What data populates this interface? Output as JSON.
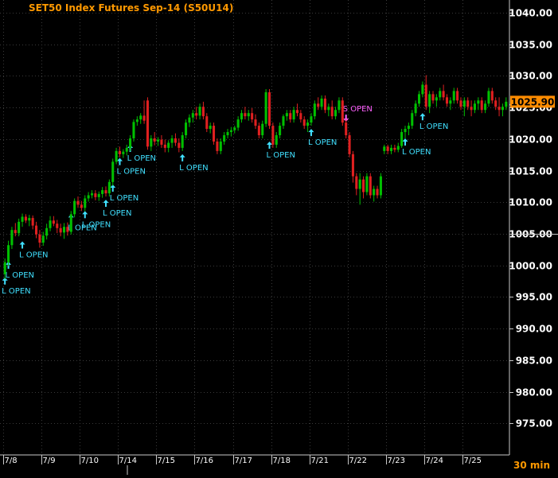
{
  "chart_data": {
    "type": "candlestick",
    "title": "SET50  Index  Futures  Sep-14  (S50U14)",
    "interval_label": "30  min",
    "current_price": "1025.90",
    "ylim": [
      970,
      1042
    ],
    "y_ticks": [
      "1040.00",
      "1035.00",
      "1030.00",
      "1025.00",
      "1020.00",
      "1015.00",
      "1010.00",
      "1005.00",
      "1000.00",
      "995.00",
      "990.00",
      "985.00",
      "980.00",
      "975.00"
    ],
    "y_tick_values": [
      1040,
      1035,
      1030,
      1025,
      1020,
      1015,
      1010,
      1005,
      1000,
      995,
      990,
      985,
      980,
      975
    ],
    "x_ticks": [
      "7/8",
      "7/9",
      "7/10",
      "7/14",
      "7/15",
      "7/16",
      "7/17",
      "7/18",
      "7/21",
      "7/22",
      "7/23",
      "7/24",
      "7/25"
    ],
    "grid": true,
    "colors": {
      "up": "#00c000",
      "down": "#e02020",
      "long_signal": "#40e0ff",
      "short_signal": "#ff60ff",
      "title": "#ff9900",
      "current_price_bg": "#ff8c00"
    },
    "candles": [
      {
        "o": 998.6,
        "h": 1001.1,
        "l": 997.8,
        "c": 1000.5
      },
      {
        "o": 1000.5,
        "h": 1003.9,
        "l": 999.9,
        "c": 1003.2
      },
      {
        "o": 1003.2,
        "h": 1006.1,
        "l": 1002.6,
        "c": 1005.6
      },
      {
        "o": 1005.6,
        "h": 1006.7,
        "l": 1004.6,
        "c": 1005.1
      },
      {
        "o": 1005.1,
        "h": 1007.4,
        "l": 1004.6,
        "c": 1006.9
      },
      {
        "o": 1006.9,
        "h": 1008.2,
        "l": 1006.1,
        "c": 1007.7
      },
      {
        "o": 1007.7,
        "h": 1008.1,
        "l": 1006.7,
        "c": 1007.1
      },
      {
        "o": 1007.1,
        "h": 1008.0,
        "l": 1006.2,
        "c": 1007.5
      },
      {
        "o": 1007.5,
        "h": 1007.9,
        "l": 1005.7,
        "c": 1006.3
      },
      {
        "o": 1006.3,
        "h": 1006.9,
        "l": 1004.3,
        "c": 1004.9
      },
      {
        "o": 1004.9,
        "h": 1005.6,
        "l": 1002.8,
        "c": 1003.6
      },
      {
        "o": 1003.6,
        "h": 1005.3,
        "l": 1003.1,
        "c": 1004.7
      },
      {
        "o": 1004.7,
        "h": 1006.6,
        "l": 1004.1,
        "c": 1005.9
      },
      {
        "o": 1005.9,
        "h": 1007.8,
        "l": 1005.4,
        "c": 1007.1
      },
      {
        "o": 1007.1,
        "h": 1007.8,
        "l": 1006.2,
        "c": 1006.6
      },
      {
        "o": 1006.6,
        "h": 1007.2,
        "l": 1005.1,
        "c": 1005.9
      },
      {
        "o": 1005.9,
        "h": 1006.6,
        "l": 1004.6,
        "c": 1005.2
      },
      {
        "o": 1005.2,
        "h": 1006.7,
        "l": 1004.2,
        "c": 1006.1
      },
      {
        "o": 1006.1,
        "h": 1006.8,
        "l": 1004.7,
        "c": 1005.3
      },
      {
        "o": 1005.3,
        "h": 1008.6,
        "l": 1004.9,
        "c": 1008.1
      },
      {
        "o": 1008.1,
        "h": 1010.6,
        "l": 1007.6,
        "c": 1010.2
      },
      {
        "o": 1010.2,
        "h": 1010.9,
        "l": 1009.1,
        "c": 1009.6
      },
      {
        "o": 1009.6,
        "h": 1010.2,
        "l": 1008.6,
        "c": 1009.1
      },
      {
        "o": 1009.1,
        "h": 1011.1,
        "l": 1008.6,
        "c": 1010.6
      },
      {
        "o": 1010.6,
        "h": 1011.6,
        "l": 1010.1,
        "c": 1011.1
      },
      {
        "o": 1011.1,
        "h": 1011.9,
        "l": 1010.6,
        "c": 1011.4
      },
      {
        "o": 1011.4,
        "h": 1011.9,
        "l": 1010.3,
        "c": 1010.8
      },
      {
        "o": 1010.8,
        "h": 1011.7,
        "l": 1010.2,
        "c": 1011.3
      },
      {
        "o": 1011.3,
        "h": 1012.4,
        "l": 1010.7,
        "c": 1011.9
      },
      {
        "o": 1011.9,
        "h": 1012.5,
        "l": 1010.9,
        "c": 1011.4
      },
      {
        "o": 1011.4,
        "h": 1013.6,
        "l": 1010.9,
        "c": 1013.2
      },
      {
        "o": 1013.2,
        "h": 1016.9,
        "l": 1012.6,
        "c": 1016.4
      },
      {
        "o": 1016.4,
        "h": 1018.6,
        "l": 1016.0,
        "c": 1018.1
      },
      {
        "o": 1018.1,
        "h": 1018.8,
        "l": 1017.1,
        "c": 1017.6
      },
      {
        "o": 1017.6,
        "h": 1018.4,
        "l": 1017.0,
        "c": 1018.0
      },
      {
        "o": 1018.0,
        "h": 1019.1,
        "l": 1017.4,
        "c": 1018.6
      },
      {
        "o": 1018.6,
        "h": 1020.6,
        "l": 1018.1,
        "c": 1020.1
      },
      {
        "o": 1020.1,
        "h": 1023.1,
        "l": 1019.6,
        "c": 1022.7
      },
      {
        "o": 1022.7,
        "h": 1023.6,
        "l": 1022.1,
        "c": 1023.1
      },
      {
        "o": 1023.1,
        "h": 1024.1,
        "l": 1022.4,
        "c": 1023.7
      },
      {
        "o": 1023.7,
        "h": 1026.1,
        "l": 1022.4,
        "c": 1022.9
      },
      {
        "o": 1026.1,
        "h": 1026.6,
        "l": 1018.3,
        "c": 1018.8
      },
      {
        "o": 1018.8,
        "h": 1020.6,
        "l": 1018.1,
        "c": 1020.1
      },
      {
        "o": 1020.1,
        "h": 1021.1,
        "l": 1019.0,
        "c": 1019.6
      },
      {
        "o": 1019.6,
        "h": 1020.3,
        "l": 1018.9,
        "c": 1019.9
      },
      {
        "o": 1019.9,
        "h": 1020.6,
        "l": 1018.6,
        "c": 1019.1
      },
      {
        "o": 1019.1,
        "h": 1019.9,
        "l": 1017.9,
        "c": 1018.6
      },
      {
        "o": 1018.6,
        "h": 1019.8,
        "l": 1017.9,
        "c": 1019.4
      },
      {
        "o": 1019.4,
        "h": 1020.6,
        "l": 1018.6,
        "c": 1020.1
      },
      {
        "o": 1020.1,
        "h": 1020.9,
        "l": 1018.9,
        "c": 1019.4
      },
      {
        "o": 1019.4,
        "h": 1020.1,
        "l": 1017.9,
        "c": 1018.6
      },
      {
        "o": 1018.6,
        "h": 1021.1,
        "l": 1018.1,
        "c": 1020.6
      },
      {
        "o": 1020.6,
        "h": 1023.1,
        "l": 1020.1,
        "c": 1022.6
      },
      {
        "o": 1022.6,
        "h": 1023.9,
        "l": 1021.9,
        "c": 1023.4
      },
      {
        "o": 1023.4,
        "h": 1024.6,
        "l": 1022.6,
        "c": 1024.1
      },
      {
        "o": 1024.1,
        "h": 1025.1,
        "l": 1023.1,
        "c": 1023.7
      },
      {
        "o": 1023.7,
        "h": 1025.6,
        "l": 1023.1,
        "c": 1025.1
      },
      {
        "o": 1025.1,
        "h": 1025.9,
        "l": 1023.1,
        "c": 1023.6
      },
      {
        "o": 1023.6,
        "h": 1024.1,
        "l": 1021.1,
        "c": 1021.6
      },
      {
        "o": 1021.6,
        "h": 1022.6,
        "l": 1020.9,
        "c": 1022.1
      },
      {
        "o": 1022.1,
        "h": 1022.6,
        "l": 1019.1,
        "c": 1019.6
      },
      {
        "o": 1019.6,
        "h": 1020.1,
        "l": 1017.6,
        "c": 1018.1
      },
      {
        "o": 1018.1,
        "h": 1020.1,
        "l": 1017.6,
        "c": 1019.6
      },
      {
        "o": 1019.6,
        "h": 1021.1,
        "l": 1019.1,
        "c": 1020.6
      },
      {
        "o": 1020.6,
        "h": 1021.6,
        "l": 1020.1,
        "c": 1021.1
      },
      {
        "o": 1021.1,
        "h": 1021.9,
        "l": 1020.4,
        "c": 1021.4
      },
      {
        "o": 1021.4,
        "h": 1022.1,
        "l": 1020.9,
        "c": 1021.8
      },
      {
        "o": 1021.8,
        "h": 1023.6,
        "l": 1021.3,
        "c": 1023.1
      },
      {
        "o": 1023.1,
        "h": 1024.6,
        "l": 1022.6,
        "c": 1024.1
      },
      {
        "o": 1024.1,
        "h": 1025.1,
        "l": 1023.1,
        "c": 1023.6
      },
      {
        "o": 1023.6,
        "h": 1024.6,
        "l": 1022.9,
        "c": 1024.1
      },
      {
        "o": 1024.1,
        "h": 1024.9,
        "l": 1022.6,
        "c": 1023.1
      },
      {
        "o": 1023.1,
        "h": 1023.9,
        "l": 1021.6,
        "c": 1022.1
      },
      {
        "o": 1022.1,
        "h": 1022.6,
        "l": 1020.1,
        "c": 1020.6
      },
      {
        "o": 1020.6,
        "h": 1022.9,
        "l": 1020.1,
        "c": 1022.4
      },
      {
        "o": 1022.4,
        "h": 1027.9,
        "l": 1021.9,
        "c": 1027.4
      },
      {
        "o": 1027.4,
        "h": 1027.9,
        "l": 1021.6,
        "c": 1022.1
      },
      {
        "o": 1022.1,
        "h": 1022.6,
        "l": 1018.6,
        "c": 1019.1
      },
      {
        "o": 1019.1,
        "h": 1021.1,
        "l": 1018.6,
        "c": 1020.6
      },
      {
        "o": 1020.6,
        "h": 1022.6,
        "l": 1020.1,
        "c": 1022.1
      },
      {
        "o": 1022.1,
        "h": 1023.9,
        "l": 1021.6,
        "c": 1023.6
      },
      {
        "o": 1023.6,
        "h": 1024.6,
        "l": 1022.9,
        "c": 1024.1
      },
      {
        "o": 1024.1,
        "h": 1024.6,
        "l": 1022.6,
        "c": 1023.1
      },
      {
        "o": 1023.1,
        "h": 1025.1,
        "l": 1022.6,
        "c": 1024.6
      },
      {
        "o": 1024.6,
        "h": 1025.6,
        "l": 1023.6,
        "c": 1024.1
      },
      {
        "o": 1024.1,
        "h": 1024.6,
        "l": 1022.6,
        "c": 1023.1
      },
      {
        "o": 1023.1,
        "h": 1023.6,
        "l": 1021.6,
        "c": 1022.1
      },
      {
        "o": 1022.1,
        "h": 1023.1,
        "l": 1021.1,
        "c": 1022.6
      },
      {
        "o": 1022.6,
        "h": 1024.1,
        "l": 1022.1,
        "c": 1023.6
      },
      {
        "o": 1023.6,
        "h": 1026.1,
        "l": 1023.1,
        "c": 1025.6
      },
      {
        "o": 1025.6,
        "h": 1026.6,
        "l": 1024.6,
        "c": 1025.1
      },
      {
        "o": 1025.1,
        "h": 1026.9,
        "l": 1024.6,
        "c": 1026.4
      },
      {
        "o": 1026.4,
        "h": 1026.9,
        "l": 1024.1,
        "c": 1024.6
      },
      {
        "o": 1024.6,
        "h": 1025.6,
        "l": 1023.6,
        "c": 1025.1
      },
      {
        "o": 1025.1,
        "h": 1026.1,
        "l": 1023.1,
        "c": 1023.6
      },
      {
        "o": 1023.6,
        "h": 1025.1,
        "l": 1023.1,
        "c": 1024.6
      },
      {
        "o": 1024.6,
        "h": 1026.6,
        "l": 1024.1,
        "c": 1026.1
      },
      {
        "o": 1026.1,
        "h": 1026.6,
        "l": 1022.1,
        "c": 1022.6
      },
      {
        "o": 1022.6,
        "h": 1023.1,
        "l": 1020.1,
        "c": 1020.6
      },
      {
        "o": 1020.6,
        "h": 1021.1,
        "l": 1017.1,
        "c": 1017.6
      },
      {
        "o": 1017.6,
        "h": 1018.1,
        "l": 1013.1,
        "c": 1014.1
      },
      {
        "o": 1014.1,
        "h": 1014.6,
        "l": 1011.1,
        "c": 1012.1
      },
      {
        "o": 1012.1,
        "h": 1014.6,
        "l": 1009.6,
        "c": 1013.6
      },
      {
        "o": 1013.6,
        "h": 1014.1,
        "l": 1010.6,
        "c": 1011.6
      },
      {
        "o": 1011.6,
        "h": 1014.6,
        "l": 1011.1,
        "c": 1014.1
      },
      {
        "o": 1014.1,
        "h": 1014.6,
        "l": 1010.6,
        "c": 1011.1
      },
      {
        "o": 1011.1,
        "h": 1012.6,
        "l": 1010.1,
        "c": 1012.1
      },
      {
        "o": 1012.1,
        "h": 1012.6,
        "l": 1010.6,
        "c": 1011.1
      },
      {
        "o": 1011.1,
        "h": 1014.6,
        "l": 1010.6,
        "c": 1014.1
      },
      {
        "o": 1018.1,
        "h": 1019.1,
        "l": 1017.6,
        "c": 1018.8
      },
      {
        "o": 1018.8,
        "h": 1019.1,
        "l": 1017.6,
        "c": 1018.1
      },
      {
        "o": 1018.1,
        "h": 1019.1,
        "l": 1017.6,
        "c": 1018.6
      },
      {
        "o": 1018.6,
        "h": 1019.1,
        "l": 1017.9,
        "c": 1018.3
      },
      {
        "o": 1018.3,
        "h": 1019.4,
        "l": 1017.9,
        "c": 1018.9
      },
      {
        "o": 1018.9,
        "h": 1021.6,
        "l": 1018.6,
        "c": 1021.1
      },
      {
        "o": 1021.1,
        "h": 1022.1,
        "l": 1020.1,
        "c": 1021.6
      },
      {
        "o": 1021.6,
        "h": 1022.6,
        "l": 1020.6,
        "c": 1022.1
      },
      {
        "o": 1022.1,
        "h": 1024.6,
        "l": 1021.6,
        "c": 1024.1
      },
      {
        "o": 1024.1,
        "h": 1026.1,
        "l": 1023.6,
        "c": 1025.6
      },
      {
        "o": 1025.6,
        "h": 1027.6,
        "l": 1025.1,
        "c": 1027.1
      },
      {
        "o": 1027.1,
        "h": 1029.1,
        "l": 1026.6,
        "c": 1028.6
      },
      {
        "o": 1028.6,
        "h": 1030.1,
        "l": 1024.6,
        "c": 1025.1
      },
      {
        "o": 1025.1,
        "h": 1027.6,
        "l": 1024.1,
        "c": 1027.1
      },
      {
        "o": 1027.1,
        "h": 1027.6,
        "l": 1025.6,
        "c": 1026.1
      },
      {
        "o": 1026.1,
        "h": 1027.1,
        "l": 1025.1,
        "c": 1026.6
      },
      {
        "o": 1026.6,
        "h": 1028.1,
        "l": 1026.1,
        "c": 1027.6
      },
      {
        "o": 1027.6,
        "h": 1028.6,
        "l": 1026.1,
        "c": 1026.6
      },
      {
        "o": 1026.6,
        "h": 1027.1,
        "l": 1025.1,
        "c": 1025.6
      },
      {
        "o": 1025.6,
        "h": 1026.6,
        "l": 1024.6,
        "c": 1026.1
      },
      {
        "o": 1026.1,
        "h": 1028.1,
        "l": 1025.6,
        "c": 1027.6
      },
      {
        "o": 1027.6,
        "h": 1028.1,
        "l": 1025.6,
        "c": 1026.1
      },
      {
        "o": 1026.1,
        "h": 1026.6,
        "l": 1024.6,
        "c": 1025.1
      },
      {
        "o": 1025.1,
        "h": 1026.6,
        "l": 1023.6,
        "c": 1026.1
      },
      {
        "o": 1026.1,
        "h": 1026.6,
        "l": 1024.6,
        "c": 1025.1
      },
      {
        "o": 1025.1,
        "h": 1026.1,
        "l": 1023.6,
        "c": 1024.6
      },
      {
        "o": 1024.6,
        "h": 1026.1,
        "l": 1024.1,
        "c": 1025.6
      },
      {
        "o": 1025.6,
        "h": 1026.6,
        "l": 1024.6,
        "c": 1026.1
      },
      {
        "o": 1026.1,
        "h": 1026.6,
        "l": 1024.1,
        "c": 1024.6
      },
      {
        "o": 1024.6,
        "h": 1026.1,
        "l": 1024.1,
        "c": 1025.6
      },
      {
        "o": 1025.6,
        "h": 1028.1,
        "l": 1025.1,
        "c": 1027.6
      },
      {
        "o": 1027.6,
        "h": 1028.1,
        "l": 1025.6,
        "c": 1026.1
      },
      {
        "o": 1026.1,
        "h": 1026.6,
        "l": 1024.6,
        "c": 1025.1
      },
      {
        "o": 1025.1,
        "h": 1026.6,
        "l": 1023.6,
        "c": 1024.6
      },
      {
        "o": 1024.6,
        "h": 1025.6,
        "l": 1023.6,
        "c": 1025.1
      },
      {
        "o": 1025.1,
        "h": 1026.6,
        "l": 1024.6,
        "c": 1025.9
      }
    ],
    "signals": [
      {
        "type": "long",
        "label": "L  OPEN",
        "bar": 0,
        "price": 998.6
      },
      {
        "type": "long",
        "label": "L  OPEN",
        "bar": 1,
        "price": 1001.1
      },
      {
        "type": "long",
        "label": "L  OPEN",
        "bar": 5,
        "price": 1004.3
      },
      {
        "type": "long",
        "label": "L  OPEN",
        "bar": 19,
        "price": 1008.6
      },
      {
        "type": "long",
        "label": "L  OPEN",
        "bar": 23,
        "price": 1009.1
      },
      {
        "type": "long",
        "label": "L  OPEN",
        "bar": 29,
        "price": 1010.9
      },
      {
        "type": "long",
        "label": "L  OPEN",
        "bar": 31,
        "price": 1013.3
      },
      {
        "type": "long",
        "label": "L  OPEN",
        "bar": 33,
        "price": 1017.5
      },
      {
        "type": "long",
        "label": "L  OPEN",
        "bar": 36,
        "price": 1019.6
      },
      {
        "type": "long",
        "label": "L  OPEN",
        "bar": 51,
        "price": 1018.1
      },
      {
        "type": "long",
        "label": "L  OPEN",
        "bar": 76,
        "price": 1020.1
      },
      {
        "type": "long",
        "label": "L  OPEN",
        "bar": 88,
        "price": 1022.1
      },
      {
        "type": "short",
        "label": "S  OPEN",
        "bar": 98,
        "price": 1022.1
      },
      {
        "type": "long",
        "label": "L  OPEN",
        "bar": 115,
        "price": 1020.6
      },
      {
        "type": "long",
        "label": "L  OPEN",
        "bar": 120,
        "price": 1024.6
      }
    ]
  }
}
